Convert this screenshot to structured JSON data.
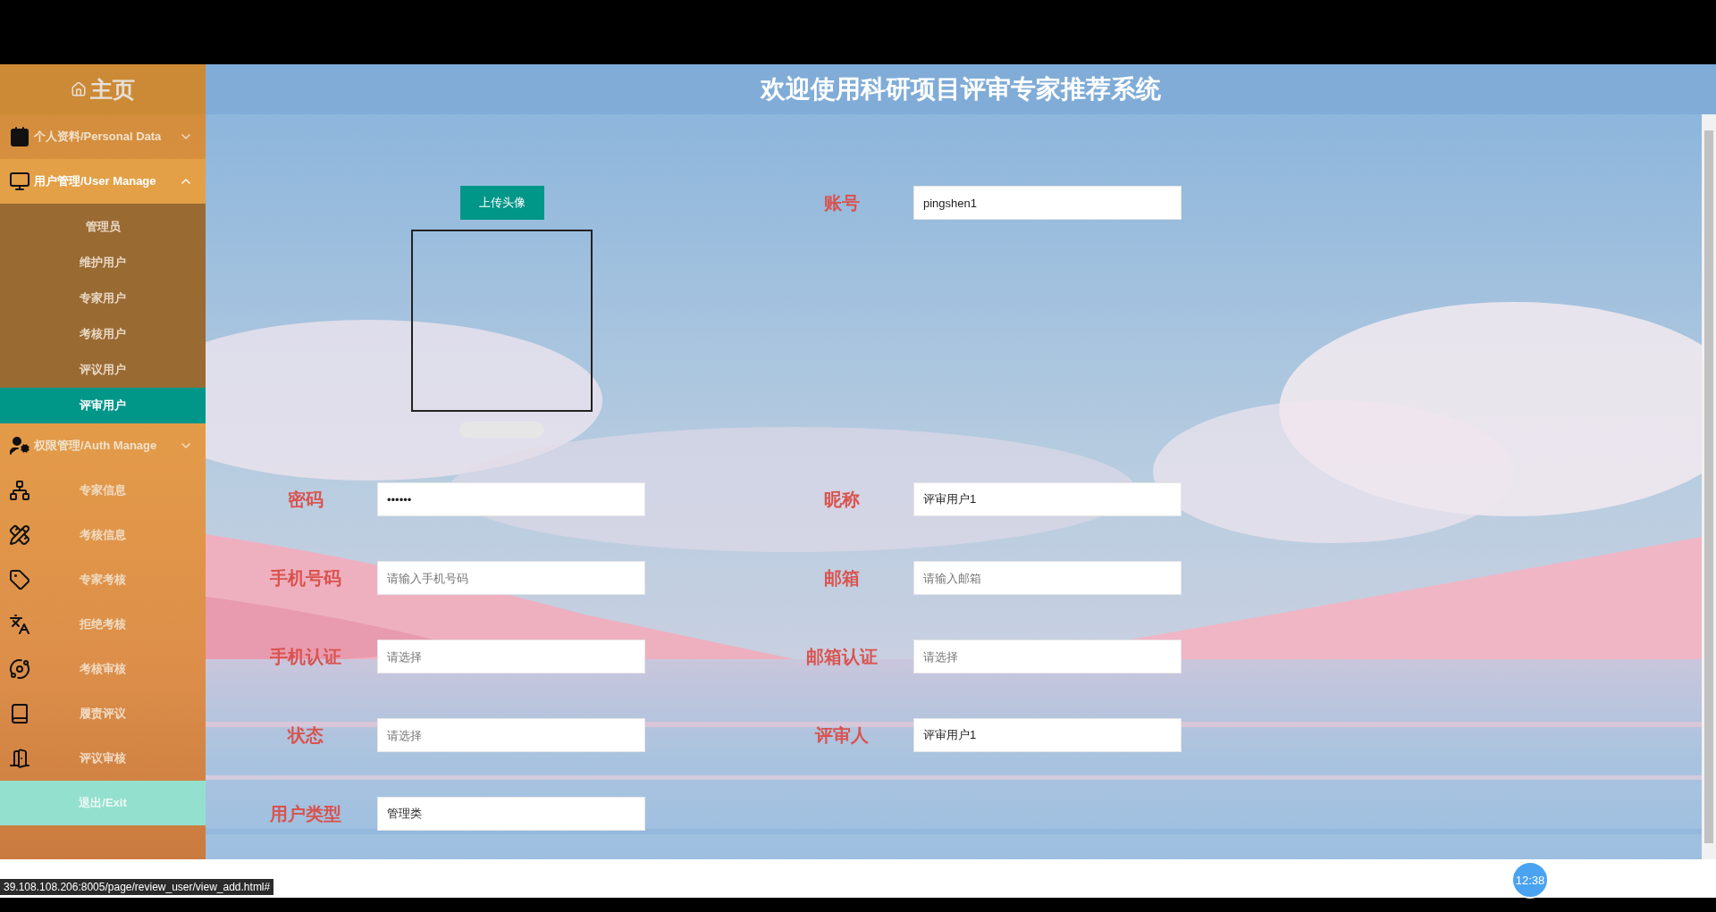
{
  "sidebar": {
    "home": "主页",
    "groups": [
      {
        "label": "个人资料/Personal Data",
        "expanded": false
      },
      {
        "label": "用户管理/User Manage",
        "expanded": true,
        "items": [
          {
            "label": "管理员",
            "selected": false
          },
          {
            "label": "维护用户",
            "selected": false
          },
          {
            "label": "专家用户",
            "selected": false
          },
          {
            "label": "考核用户",
            "selected": false
          },
          {
            "label": "评议用户",
            "selected": false
          },
          {
            "label": "评审用户",
            "selected": true
          }
        ]
      },
      {
        "label": "权限管理/Auth Manage",
        "expanded": false
      }
    ],
    "links": [
      {
        "label": "专家信息"
      },
      {
        "label": "考核信息"
      },
      {
        "label": "专家考核"
      },
      {
        "label": "拒绝考核"
      },
      {
        "label": "考核审核"
      },
      {
        "label": "履责评议"
      },
      {
        "label": "评议审核"
      }
    ],
    "exit": "退出/Exit"
  },
  "header": {
    "title": "欢迎使用科研项目评审专家推荐系统"
  },
  "form": {
    "upload_button": "上传头像",
    "account": {
      "label": "账号",
      "value": "pingshen1"
    },
    "fields": [
      {
        "label": "密码",
        "value": "••••••"
      },
      {
        "label": "昵称",
        "value": "评审用户1"
      },
      {
        "label": "手机号码",
        "placeholder": "请输入手机号码"
      },
      {
        "label": "邮箱",
        "placeholder": "请输入邮箱"
      },
      {
        "label": "手机认证",
        "placeholder": "请选择"
      },
      {
        "label": "邮箱认证",
        "placeholder": "请选择"
      },
      {
        "label": "状态",
        "placeholder": "请选择"
      },
      {
        "label": "评审人",
        "value": "评审用户1"
      },
      {
        "label": "用户类型",
        "value": "管理类"
      }
    ]
  },
  "status_url": "39.108.108.206:8005/page/review_user/view_add.html#",
  "timer_badge": "12:38"
}
